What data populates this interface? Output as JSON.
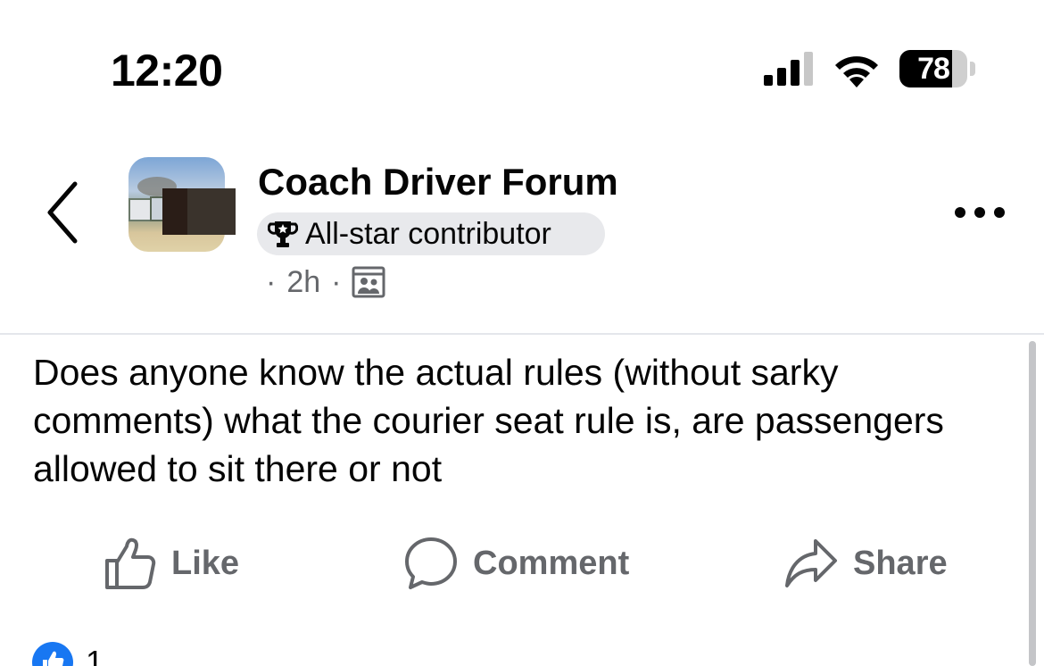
{
  "status_bar": {
    "time": "12:20",
    "battery_percent": "78",
    "battery_level": 0.78,
    "signal_bars_active": 3
  },
  "header": {
    "group_name": "Coach Driver Forum",
    "badge_label": "All-star contributor",
    "dot": "·",
    "time_ago": "2h",
    "icons": {
      "back": "chevron-left-icon",
      "badge": "trophy-icon",
      "audience": "group-members-icon",
      "more": "more-horizontal-icon"
    }
  },
  "post": {
    "text": "Does anyone know the actual rules (without sarky comments) what the courier seat rule is, are passengers allowed to sit there or not"
  },
  "actions": {
    "like_label": "Like",
    "comment_label": "Comment",
    "share_label": "Share"
  },
  "reactions": {
    "count": "1",
    "type": "like"
  },
  "colors": {
    "primary_text": "#050505",
    "secondary_text": "#65676b",
    "badge_bg": "#e8e9ec",
    "divider": "#e4e6eb",
    "facebook_blue": "#1877f2"
  }
}
